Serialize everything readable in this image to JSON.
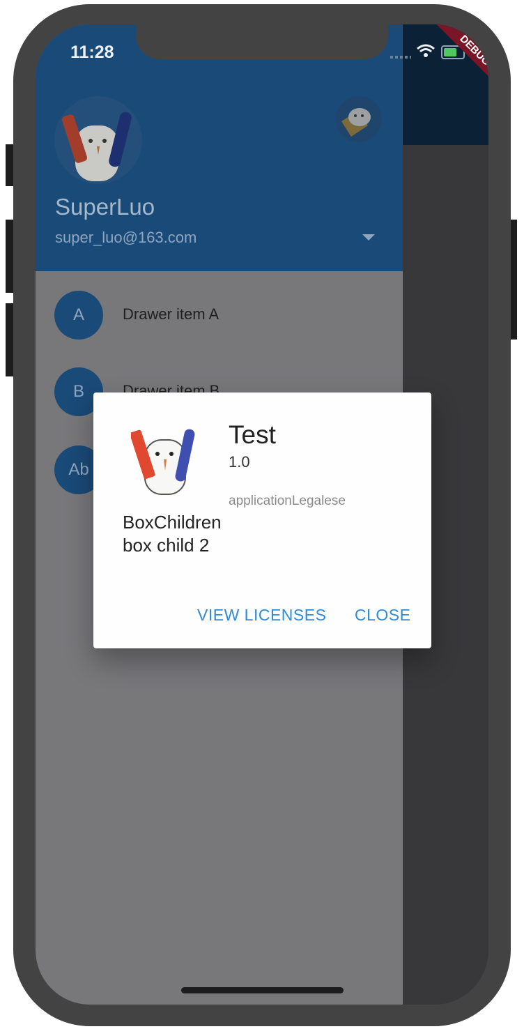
{
  "status_bar": {
    "time": "11:28"
  },
  "debug_banner": {
    "label": "DEBUG"
  },
  "drawer": {
    "header": {
      "account_name": "SuperLuo",
      "account_email": "super_luo@163.com"
    },
    "items": [
      {
        "avatar_text": "A",
        "label": "Drawer item A"
      },
      {
        "avatar_text": "B",
        "label": "Drawer item B"
      },
      {
        "avatar_text": "Ab",
        "label": ""
      }
    ]
  },
  "about_dialog": {
    "title": "Test",
    "version": "1.0",
    "legalese": "applicationLegalese",
    "box_children": [
      "BoxChildren",
      "box child 2"
    ],
    "buttons": {
      "view_licenses": "VIEW LICENSES",
      "close": "CLOSE"
    }
  },
  "colors": {
    "drawer_header": "#1a4a78",
    "accent": "#2f8bd6",
    "debug_banner": "#7a1626"
  }
}
